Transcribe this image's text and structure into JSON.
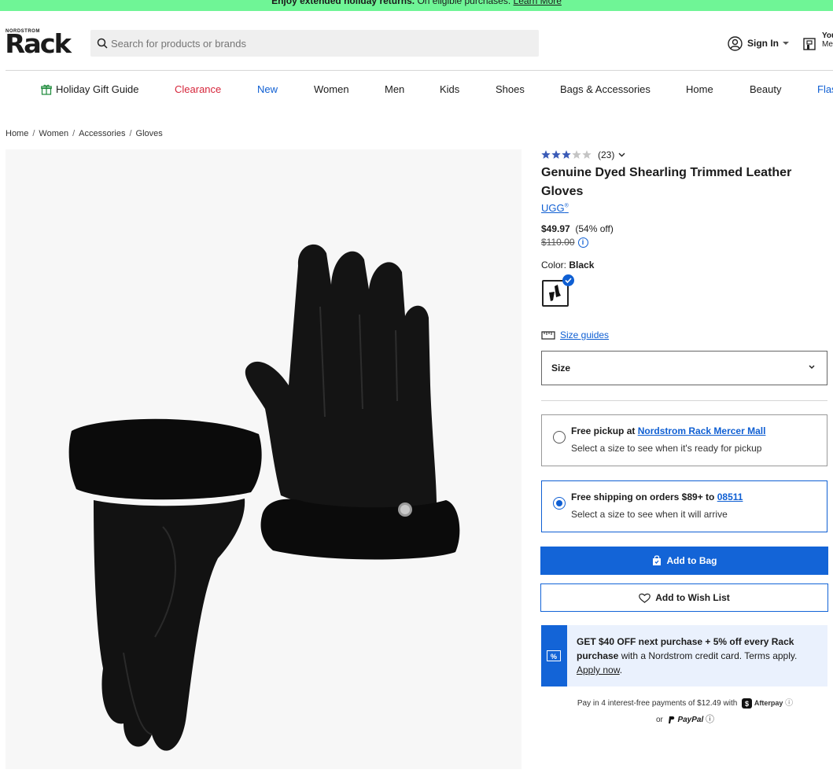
{
  "banner": {
    "bold": "Enjoy extended holiday returns.",
    "rest": " On eligible purchases.",
    "link": "Learn More"
  },
  "header": {
    "logo_small": "NORDSTROM",
    "logo_big": "Rack",
    "search_placeholder": "Search for products or brands",
    "sign_in": "Sign In",
    "your_menu_1": "You",
    "your_menu_2": "Me"
  },
  "nav": {
    "items": [
      "Holiday Gift Guide",
      "Clearance",
      "New",
      "Women",
      "Men",
      "Kids",
      "Shoes",
      "Bags & Accessories",
      "Home",
      "Beauty",
      "Flas"
    ]
  },
  "breadcrumb": [
    "Home",
    "Women",
    "Accessories",
    "Gloves"
  ],
  "product": {
    "rating_count": "(23)",
    "rating": 3,
    "rating_max": 5,
    "title": "Genuine Dyed Shearling Trimmed Leather Gloves",
    "brand": "UGG",
    "brand_mark": "®",
    "price": "$49.97",
    "discount": "(54% off)",
    "original_price": "$110.00",
    "color_label": "Color:",
    "color_value": "Black",
    "size_guides": "Size guides",
    "size_label": "Size"
  },
  "fulfillment": {
    "pickup_prefix": "Free pickup at ",
    "pickup_store": "Nordstrom Rack Mercer Mall",
    "pickup_note": "Select a size to see when it's ready for pickup",
    "ship_prefix": "Free shipping on orders $89+ to ",
    "ship_zip": "08511",
    "ship_note": "Select a size to see when it will arrive"
  },
  "actions": {
    "add_to_bag": "Add to Bag",
    "add_to_wish": "Add to Wish List"
  },
  "promo": {
    "badge": "%",
    "bold": "GET $40 OFF next purchase + 5% off every Rack purchase",
    "rest": " with a Nordstrom credit card. Terms apply.",
    "link": "Apply now",
    "end": "."
  },
  "payments": {
    "line1": "Pay in 4 interest-free payments of $12.49 with",
    "afterpay": "Afterpay",
    "or": "or",
    "paypal": "PayPal"
  },
  "colors": {
    "accent": "#1364d7",
    "clearance": "#d6263b",
    "banner": "#6ff596",
    "star": "#3b5bb7"
  }
}
